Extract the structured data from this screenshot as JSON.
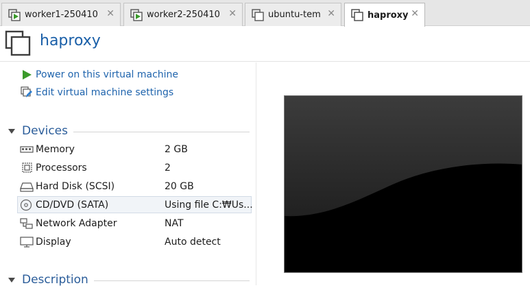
{
  "tabs": [
    {
      "label": "worker1-250410",
      "active": false,
      "icon": "vm-running-icon"
    },
    {
      "label": "worker2-250410",
      "active": false,
      "icon": "vm-running-icon"
    },
    {
      "label": "ubuntu-tem",
      "active": false,
      "icon": "vm-icon"
    },
    {
      "label": "haproxy",
      "active": true,
      "icon": "vm-icon"
    }
  ],
  "tab_close_glyph": "✕",
  "header": {
    "title": "haproxy",
    "icon": "vm-icon"
  },
  "actions": [
    {
      "label": "Power on this virtual machine",
      "icon": "play-icon"
    },
    {
      "label": "Edit virtual machine settings",
      "icon": "edit-settings-icon"
    }
  ],
  "sections": {
    "devices": "Devices",
    "description": "Description"
  },
  "devices": [
    {
      "name": "Memory",
      "value": "2 GB",
      "icon": "memory-icon"
    },
    {
      "name": "Processors",
      "value": "2",
      "icon": "processor-icon"
    },
    {
      "name": "Hard Disk (SCSI)",
      "value": "20 GB",
      "icon": "hard-disk-icon"
    },
    {
      "name": "CD/DVD (SATA)",
      "value": "Using file C:₩Us...",
      "icon": "cd-dvd-icon",
      "selected": true
    },
    {
      "name": "Network Adapter",
      "value": "NAT",
      "icon": "network-adapter-icon"
    },
    {
      "name": "Display",
      "value": "Auto detect",
      "icon": "display-icon"
    }
  ],
  "colors": {
    "accent": "#1a5fa8",
    "link": "#1f64ad",
    "play": "#3a9a2a"
  }
}
